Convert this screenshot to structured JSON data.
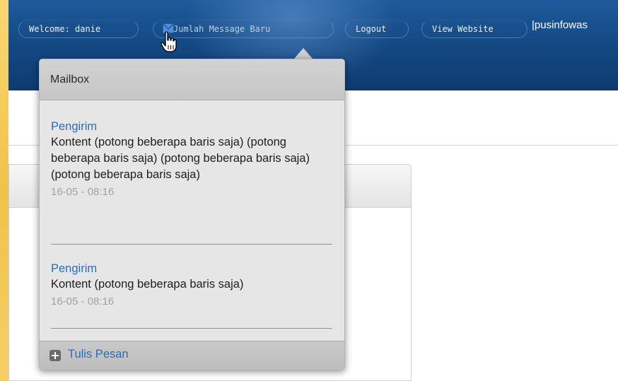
{
  "header": {
    "welcome_label": "Welcome: danie",
    "message_label": "Jumlah Message Baru",
    "logout_label": "Logout",
    "website_label": "View Website",
    "site_name": "|pusinfowas"
  },
  "mailbox": {
    "title": "Mailbox",
    "messages": [
      {
        "sender": "Pengirim",
        "content": "Kontent (potong beberapa baris saja) (potong beberapa baris saja) (potong beberapa baris saja) (potong beberapa baris saja)",
        "time": "16-05 - 08:16"
      },
      {
        "sender": "Pengirim",
        "content": "Kontent (potong beberapa baris saja)",
        "time": "16-05 - 08:16"
      }
    ],
    "compose_label": "Tulis Pesan"
  },
  "colors": {
    "header_bg": "#154a86",
    "link": "#2b6db8",
    "timestamp": "#a2a2a2"
  },
  "icons": [
    "envelope-icon",
    "hand-cursor-icon",
    "plus-icon"
  ]
}
